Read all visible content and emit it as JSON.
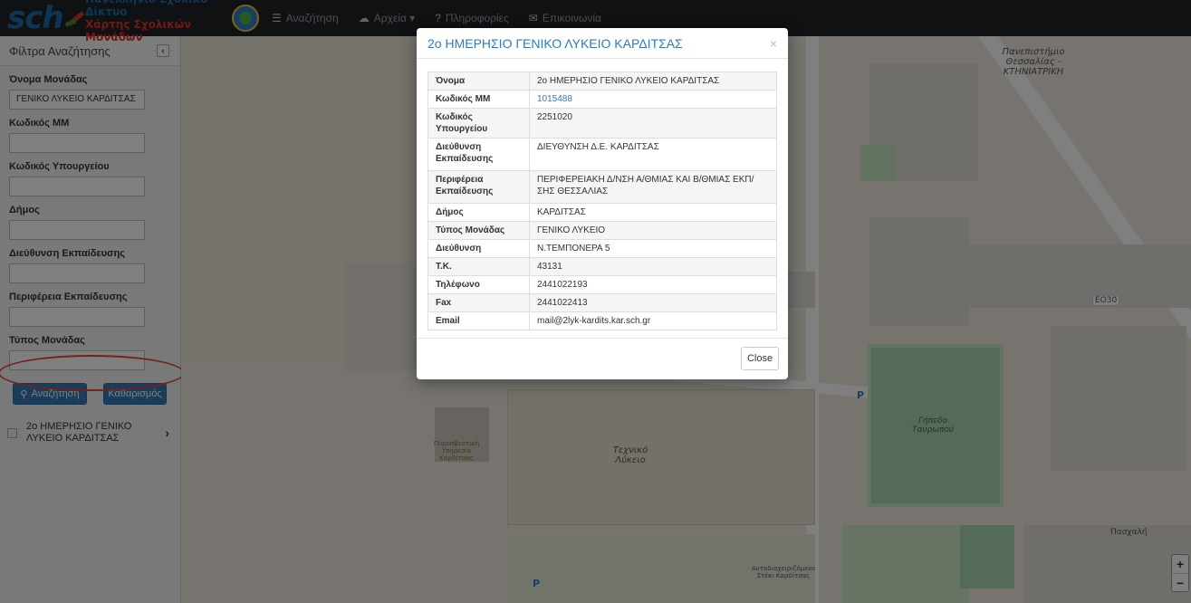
{
  "logo": {
    "brand": "sch",
    "line1": "Πανελλήνιο Σχολικό Δίκτυο",
    "line2": "Χάρτης Σχολικών Μονάδων"
  },
  "nav": {
    "search": "Αναζήτηση",
    "files": "Αρχεία ▾",
    "info": "Πληροφορίες",
    "contact": "Επικοινωνία"
  },
  "sidebar": {
    "title": "Φίλτρα Αναζήτησης",
    "collapse_icon": "‹",
    "fields": [
      {
        "label": "Όνομα Μονάδας",
        "value": "ΓΕΝΙΚΟ ΛΥΚΕΙΟ ΚΑΡΔΙΤΣΑΣ"
      },
      {
        "label": "Κωδικός ΜΜ",
        "value": ""
      },
      {
        "label": "Κωδικός Υπουργείου",
        "value": ""
      },
      {
        "label": "Δήμος",
        "value": ""
      },
      {
        "label": "Διεύθυνση Εκπαίδευσης",
        "value": ""
      },
      {
        "label": "Περιφέρεια Εκπαίδευσης",
        "value": ""
      },
      {
        "label": "Τύπος Μονάδας",
        "value": ""
      }
    ],
    "search_button": "Αναζήτηση",
    "clear_button": "Καθαρισμός",
    "result": {
      "name": "2ο ΗΜΕΡΗΣΙΟ ΓΕΝΙΚΟ ΛΥΚΕΙΟ ΚΑΡΔΙΤΣΑΣ",
      "arrow": "›"
    }
  },
  "map": {
    "labels": {
      "university": "Πανεπιστήμιο Θεσσαλίας - ΚΤΗΝΙΑΤΡΙΚΗ",
      "route": "ΕΟ30",
      "stadium": "Γήπεδο Ταυρωπού",
      "tech": "Τεχνικό Λύκειο",
      "fire": "Πυροσβεστική Υπηρεσία Καρδίτσας",
      "driving": "Αυτοδιαχειριζόμενο Στέκι Καρδίτσας",
      "parking": "P",
      "paskalis": "Πασχαλή"
    },
    "zoom_in": "+",
    "zoom_out": "−"
  },
  "modal": {
    "title": "2ο ΗΜΕΡΗΣΙΟ ΓΕΝΙΚΟ ΛΥΚΕΙΟ ΚΑΡΔΙΤΣΑΣ",
    "close_x": "×",
    "rows": [
      {
        "key": "Όνομα",
        "value": "2ο ΗΜΕΡΗΣΙΟ ΓΕΝΙΚΟ ΛΥΚΕΙΟ ΚΑΡΔΙΤΣΑΣ"
      },
      {
        "key": "Κωδικός ΜΜ",
        "value": "1015488"
      },
      {
        "key": "Κωδικός Υπουργείου",
        "value": "2251020"
      },
      {
        "key": "Διεύθυνση Εκπαίδευσης",
        "value": "ΔΙΕΥΘΥΝΣΗ Δ.Ε. ΚΑΡΔΙΤΣΑΣ"
      },
      {
        "key": "Περιφέρεια Εκπαίδευσης",
        "value": "ΠΕΡΙΦΕΡΕΙΑΚΗ Δ/ΝΣΗ Α/ΘΜΙΑΣ ΚΑΙ Β/ΘΜΙΑΣ ΕΚΠ/ΣΗΣ ΘΕΣΣΑΛΙΑΣ"
      },
      {
        "key": "Δήμος",
        "value": "ΚΑΡΔΙΤΣΑΣ"
      },
      {
        "key": "Τύπος Μονάδας",
        "value": "ΓΕΝΙΚΟ ΛΥΚΕΙΟ"
      },
      {
        "key": "Διεύθυνση",
        "value": "Ν.ΤΕΜΠΟΝΕΡΑ 5"
      },
      {
        "key": "Τ.Κ.",
        "value": "43131"
      },
      {
        "key": "Τηλέφωνο",
        "value": "2441022193"
      },
      {
        "key": "Fax",
        "value": "2441022413"
      },
      {
        "key": "Email",
        "value": "mail@2lyk-kardits.kar.sch.gr"
      }
    ],
    "close_button": "Close"
  }
}
